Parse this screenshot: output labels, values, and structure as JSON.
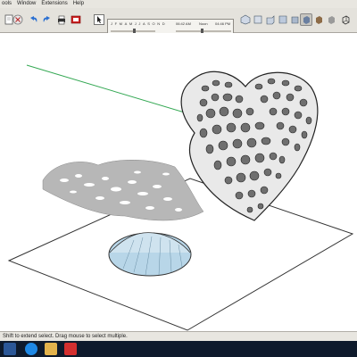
{
  "menu": {
    "items": [
      "ools",
      "Window",
      "Extensions",
      "Help"
    ]
  },
  "shadow_settings": {
    "months": [
      "J",
      "F",
      "M",
      "A",
      "M",
      "J",
      "J",
      "A",
      "S",
      "O",
      "N",
      "D"
    ],
    "start_time": "06:42 AM",
    "middle_label": "Noon",
    "end_time": "04:46 PM"
  },
  "toolbar": {
    "left_icons": [
      "document-icon",
      "error-icon",
      "undo-icon",
      "redo-icon",
      "print-icon",
      "model-info-icon"
    ],
    "right_icons": [
      "iso-view-icon",
      "top-view-icon",
      "front-view-icon",
      "right-view-icon",
      "back-view-icon",
      "left-view-icon",
      "xray-icon",
      "wireframe-icon",
      "hidden-line-icon",
      "shaded-icon",
      "textured-icon",
      "monochrome-icon"
    ]
  },
  "status": {
    "text": "Shift to extend select. Drag mouse to select multiple."
  },
  "taskbar": {
    "icons": [
      "file-explorer-icon",
      "ie-browser-icon",
      "folder-icon",
      "sketchup-icon"
    ]
  },
  "colors": {
    "axis_green": "#34a853",
    "ground": "#ffffff",
    "shadow": "#bdbdbd",
    "taskbar": "#0e1a2c"
  }
}
